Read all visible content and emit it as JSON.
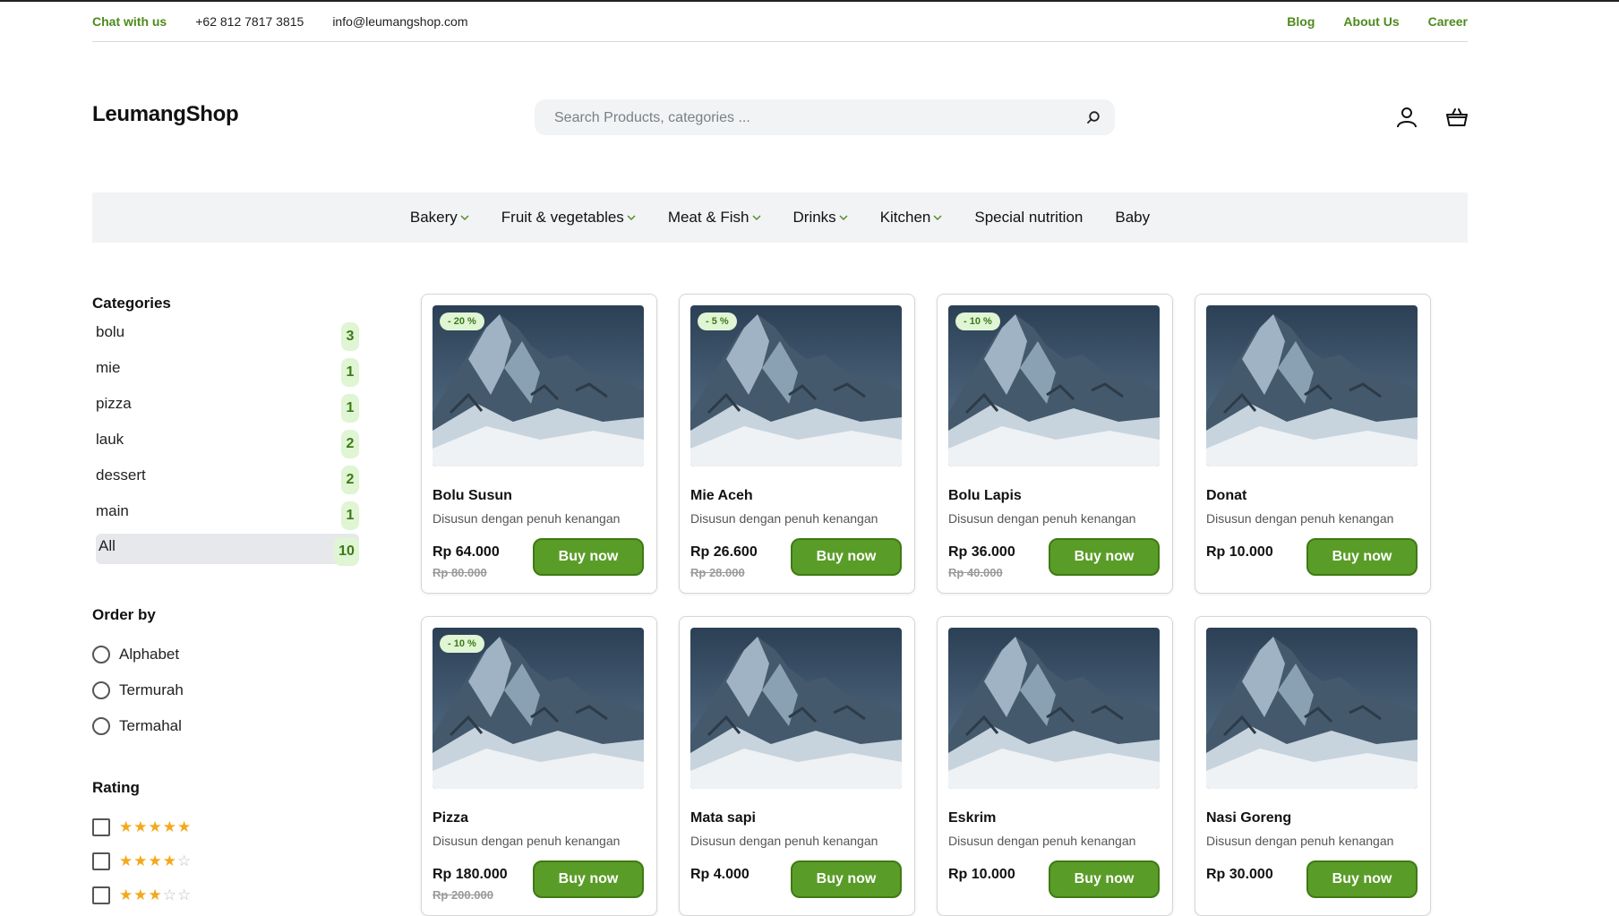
{
  "topbar": {
    "chat": "Chat with us",
    "phone": "+62 812 7817 3815",
    "email": "info@leumangshop.com",
    "links": [
      "Blog",
      "About Us",
      "Career"
    ]
  },
  "header": {
    "logo": "LeumangShop",
    "search_placeholder": "Search Products, categories ..."
  },
  "nav": [
    {
      "label": "Bakery",
      "dropdown": true
    },
    {
      "label": "Fruit & vegetables",
      "dropdown": true
    },
    {
      "label": "Meat & Fish",
      "dropdown": true
    },
    {
      "label": "Drinks",
      "dropdown": true
    },
    {
      "label": "Kitchen",
      "dropdown": true
    },
    {
      "label": "Special nutrition",
      "dropdown": false
    },
    {
      "label": "Baby",
      "dropdown": false
    }
  ],
  "sidebar": {
    "categories_title": "Categories",
    "categories": [
      {
        "label": "bolu",
        "count": "3"
      },
      {
        "label": "mie",
        "count": "1"
      },
      {
        "label": "pizza",
        "count": "1"
      },
      {
        "label": "lauk",
        "count": "2"
      },
      {
        "label": "dessert",
        "count": "2"
      },
      {
        "label": "main",
        "count": "1"
      },
      {
        "label": "All",
        "count": "10",
        "active": true
      }
    ],
    "order_title": "Order by",
    "order_options": [
      "Alphabet",
      "Termurah",
      "Termahal"
    ],
    "rating_title": "Rating",
    "ratings": [
      5,
      4,
      3
    ]
  },
  "products": [
    {
      "name": "Bolu Susun",
      "desc": "Disusun dengan penuh kenangan",
      "price": "Rp 64.000",
      "old_price": "Rp 80.000",
      "discount": "- 20 %",
      "button": "Buy now"
    },
    {
      "name": "Mie Aceh",
      "desc": "Disusun dengan penuh kenangan",
      "price": "Rp 26.600",
      "old_price": "Rp 28.000",
      "discount": "- 5 %",
      "button": "Buy now"
    },
    {
      "name": "Bolu Lapis",
      "desc": "Disusun dengan penuh kenangan",
      "price": "Rp 36.000",
      "old_price": "Rp 40.000",
      "discount": "- 10 %",
      "button": "Buy now"
    },
    {
      "name": "Donat",
      "desc": "Disusun dengan penuh kenangan",
      "price": "Rp 10.000",
      "old_price": "",
      "discount": "",
      "button": "Buy now"
    },
    {
      "name": "Pizza",
      "desc": "Disusun dengan penuh kenangan",
      "price": "Rp 180.000",
      "old_price": "Rp 200.000",
      "discount": "- 10 %",
      "button": "Buy now"
    },
    {
      "name": "Mata sapi",
      "desc": "Disusun dengan penuh kenangan",
      "price": "Rp 4.000",
      "old_price": "",
      "discount": "",
      "button": "Buy now"
    },
    {
      "name": "Eskrim",
      "desc": "Disusun dengan penuh kenangan",
      "price": "Rp 10.000",
      "old_price": "",
      "discount": "",
      "button": "Buy now"
    },
    {
      "name": "Nasi Goreng",
      "desc": "Disusun dengan penuh kenangan",
      "price": "Rp 30.000",
      "old_price": "",
      "discount": "",
      "button": "Buy now"
    }
  ],
  "colors": {
    "accent": "#5a9c28",
    "badge_bg": "#dff5d3",
    "star": "#f4a81c"
  },
  "icons": [
    "search-icon",
    "user-icon",
    "basket-icon",
    "chevron-down-icon",
    "mountain-photo"
  ]
}
